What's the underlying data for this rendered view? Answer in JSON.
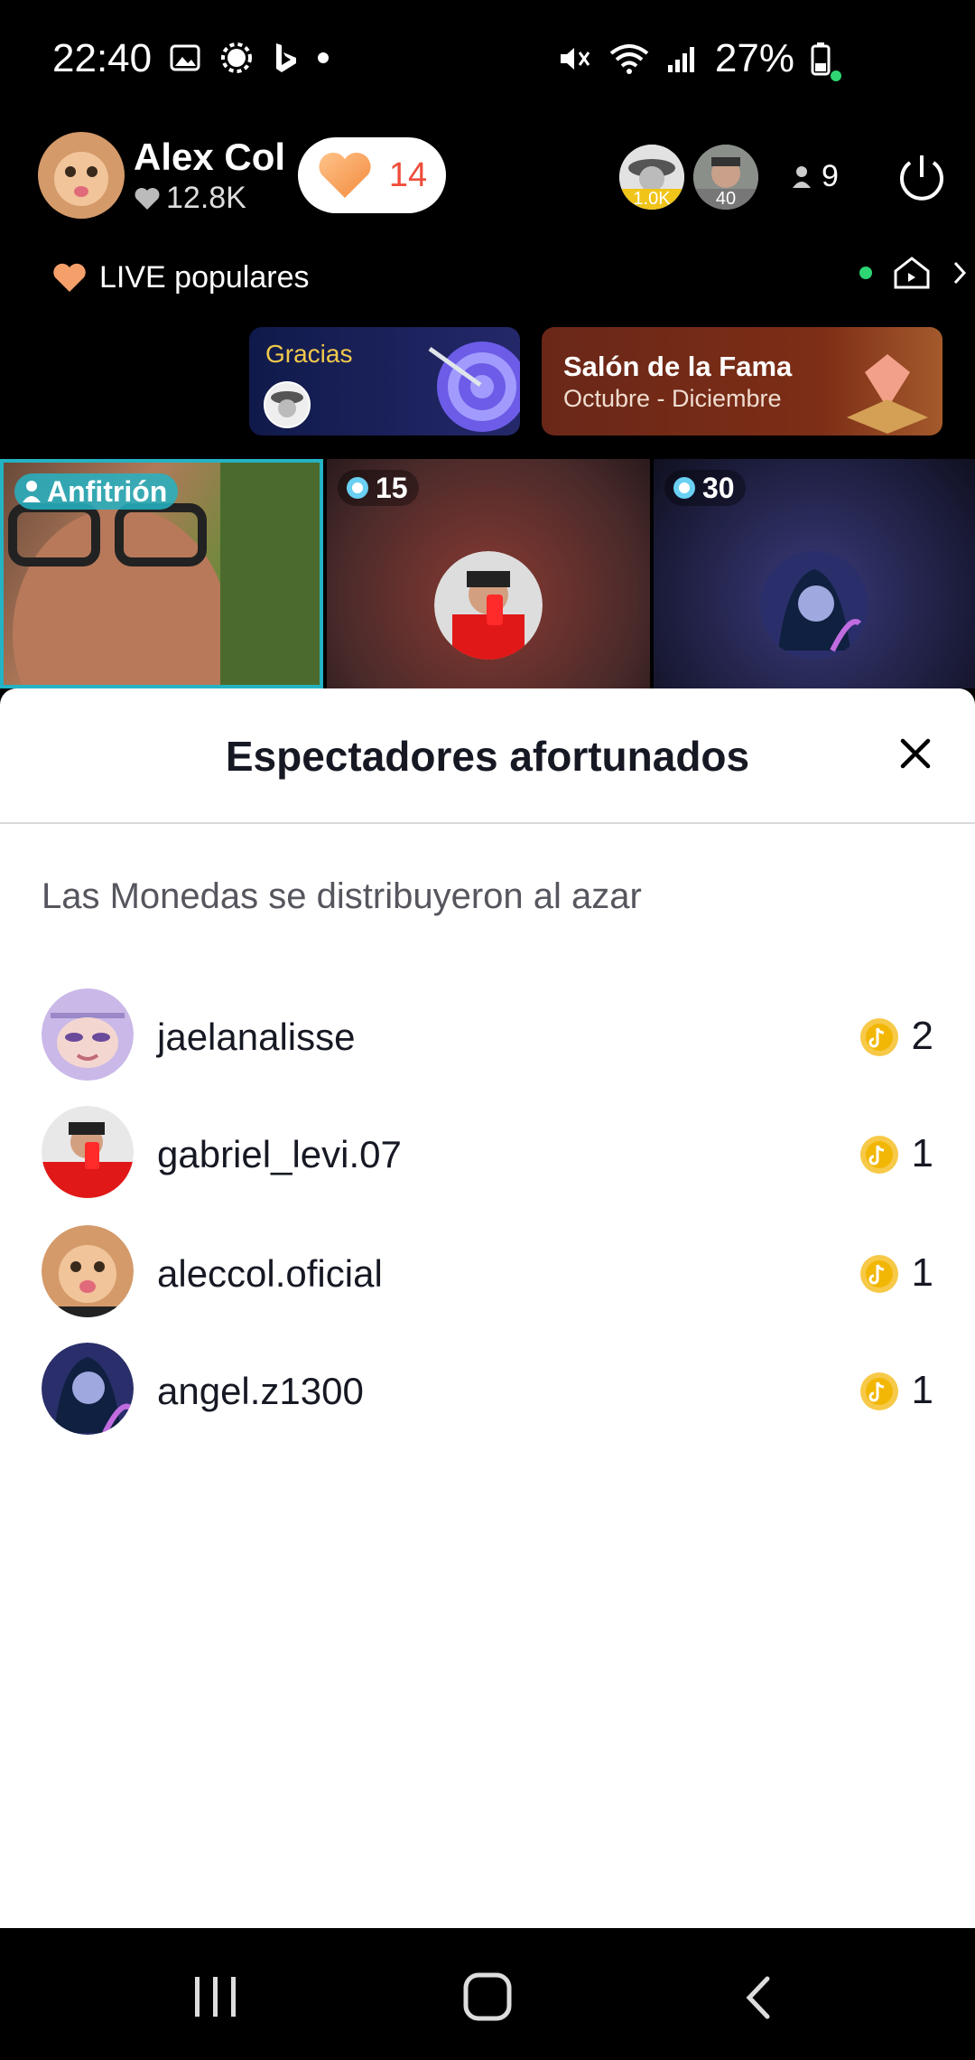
{
  "status_bar": {
    "time": "22:40",
    "battery": "27%"
  },
  "host": {
    "name": "Alex Col",
    "likes": "12.8K",
    "heart_count": "14"
  },
  "viewers": [
    {
      "badge": "1.0K"
    },
    {
      "badge": "40"
    }
  ],
  "viewer_count": "9",
  "live_popular": "LIVE populares",
  "banners": {
    "gracias": "Gracias",
    "fame_title": "Salón de la Fama",
    "fame_subtitle": "Octubre - Diciembre"
  },
  "tiles": [
    {
      "label": "Anfitrión"
    },
    {
      "label": "15"
    },
    {
      "label": "30"
    }
  ],
  "sheet": {
    "title": "Espectadores afortunados",
    "subtitle": "Las Monedas se distribuyeron al azar",
    "rows": [
      {
        "username": "jaelanalisse",
        "coins": "2"
      },
      {
        "username": "gabriel_levi.07",
        "coins": "1"
      },
      {
        "username": "aleccol.oficial",
        "coins": "1"
      },
      {
        "username": "angel.z1300",
        "coins": "1"
      }
    ]
  },
  "colors": {
    "accent_teal": "#24b3c4",
    "heart_red": "#ee4d3c",
    "coin_gold": "#f7c948"
  }
}
